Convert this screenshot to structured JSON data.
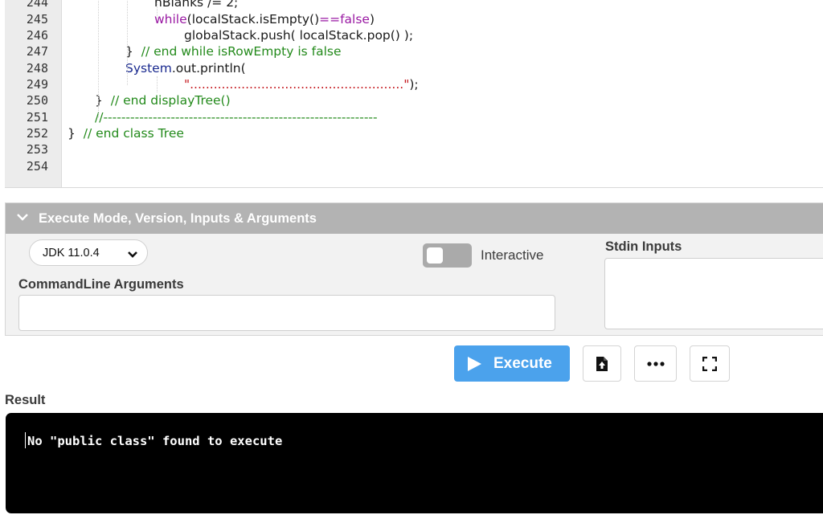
{
  "editor": {
    "line_numbers": [
      "244",
      "245",
      "246",
      "247",
      "248",
      "249",
      "250",
      "251",
      "252",
      "253",
      "254"
    ],
    "lines": [
      [
        {
          "t": "",
          "c": "n"
        },
        {
          "t": "nBlanks /= 2;",
          "c": "n"
        }
      ],
      [
        {
          "t": "while",
          "c": "kw"
        },
        {
          "t": "(localStack.isEmpty()",
          "c": "n"
        },
        {
          "t": "==false",
          "c": "kw"
        },
        {
          "t": ")",
          "c": "n"
        }
      ],
      [
        {
          "t": "globalStack.push( localStack.pop() );",
          "c": "n"
        }
      ],
      [
        {
          "t": "}  ",
          "c": "n"
        },
        {
          "t": "// end while isRowEmpty is false",
          "c": "cm"
        }
      ],
      [
        {
          "t": "System",
          "c": "id"
        },
        {
          "t": ".out.println(",
          "c": "n"
        }
      ],
      [
        {
          "t": "\"......................................................\"",
          "c": "st"
        },
        {
          "t": ");",
          "c": "n"
        }
      ],
      [
        {
          "t": "}  ",
          "c": "n"
        },
        {
          "t": "// end displayTree()",
          "c": "cm"
        }
      ],
      [
        {
          "t": "//-------------------------------------------------------------",
          "c": "cm"
        }
      ],
      [
        {
          "t": "}  ",
          "c": "n"
        },
        {
          "t": "// end class Tree",
          "c": "cm"
        }
      ],
      [],
      []
    ]
  },
  "execute_panel": {
    "header": "Execute Mode, Version, Inputs & Arguments",
    "version_select": "JDK 11.0.4",
    "interactive_label": "Interactive",
    "interactive_on": false,
    "cmd_args_label": "CommandLine Arguments",
    "cmd_args_value": "",
    "stdin_label": "Stdin Inputs",
    "stdin_value": ""
  },
  "actions": {
    "execute_label": "Execute",
    "execute_color": "#4ba2ec"
  },
  "result": {
    "label": "Result",
    "output": "No \"public class\" found to execute"
  }
}
